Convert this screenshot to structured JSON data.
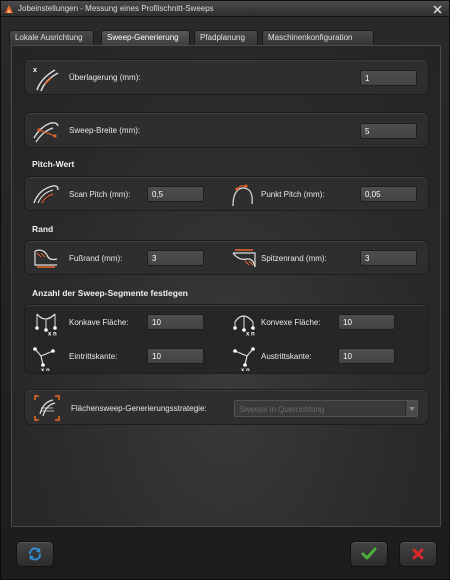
{
  "window": {
    "title": "Jobeinstellungen - Messung eines Profilschnitt-Sweeps",
    "close_symbol": "✕"
  },
  "tabs": [
    {
      "label": "Lokale Ausrichtung",
      "active": false
    },
    {
      "label": "Sweep-Generierung",
      "active": true
    },
    {
      "label": "Pfadplanung",
      "active": false
    },
    {
      "label": "Maschinenkonfiguration",
      "active": false
    }
  ],
  "overlap": {
    "label": "Überlagerung (mm):",
    "value": "1",
    "icon": "overlap-icon",
    "icon_letter": "x"
  },
  "sweep_width": {
    "label": "Sweep-Breite (mm):",
    "value": "5",
    "icon": "sweep-width-icon"
  },
  "pitch": {
    "title": "Pitch-Wert",
    "scan_label": "Scan Pitch (mm):",
    "scan_value": "0,5",
    "point_label": "Punkt Pitch (mm):",
    "point_value": "0,05"
  },
  "margin": {
    "title": "Rand",
    "foot_label": "Fußrand (mm):",
    "foot_value": "3",
    "tip_label": "Spitzenrand (mm):",
    "tip_value": "3"
  },
  "segments": {
    "title": "Anzahl der Sweep-Segmente festlegen",
    "concave_label": "Konkave Fläche:",
    "concave_value": "10",
    "convex_label": "Konvexe Fläche:",
    "convex_value": "10",
    "entry_label": "Eintrittskante:",
    "entry_value": "10",
    "exit_label": "Austrittskante:",
    "exit_value": "10",
    "icon_caption": "x n"
  },
  "strategy": {
    "label": "Flächensweep-Generierungsstrategie:",
    "selected": "Sweeps in Querrichtung"
  },
  "colors": {
    "accent_orange": "#e8652a",
    "ok_green": "#4caf3a",
    "cancel_red": "#e0282a",
    "refresh_blue": "#2f8fd6"
  }
}
